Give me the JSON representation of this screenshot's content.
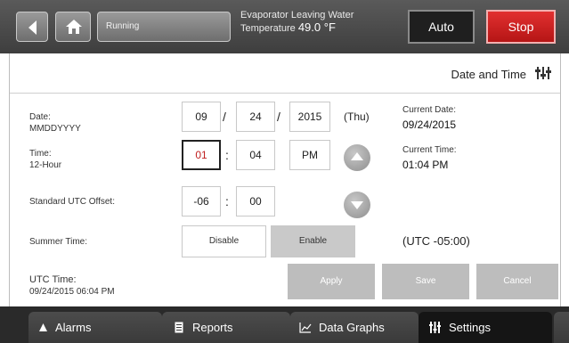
{
  "header": {
    "status_label": "Running",
    "reading_label": "Evaporator Leaving Water",
    "reading_prefix": "Temperature",
    "reading_value": "49.0 °F",
    "auto_label": "Auto",
    "stop_label": "Stop"
  },
  "panel": {
    "title": "Date and Time",
    "date": {
      "label": "Date:",
      "format": "MMDDYYYY",
      "month": "09",
      "day": "24",
      "year": "2015",
      "separator": "/",
      "weekday": "(Thu)"
    },
    "time": {
      "label": "Time:",
      "mode": "12-Hour",
      "hour": "01",
      "minute": "04",
      "separator": ":",
      "ampm": "PM"
    },
    "utc_offset": {
      "label": "Standard UTC Offset:",
      "hours": "-06",
      "minutes": "00",
      "separator": ":"
    },
    "summer_time": {
      "label": "Summer Time:",
      "disable_label": "Disable",
      "enable_label": "Enable",
      "selected": "Enable",
      "utc_now": "(UTC -05:00)"
    },
    "current_date": {
      "label": "Current Date:",
      "value": "09/24/2015"
    },
    "current_time": {
      "label": "Current Time:",
      "value": "01:04 PM"
    },
    "utc_time": {
      "label": "UTC Time:",
      "value": "09/24/2015 06:04 PM"
    },
    "actions": {
      "apply": "Apply",
      "save": "Save",
      "cancel": "Cancel"
    }
  },
  "nav": {
    "tabs": [
      {
        "label": "Alarms",
        "icon": "bell-icon"
      },
      {
        "label": "Reports",
        "icon": "document-icon"
      },
      {
        "label": "Data Graphs",
        "icon": "line-chart-icon"
      },
      {
        "label": "Settings",
        "icon": "sliders-icon",
        "active": true
      }
    ]
  },
  "colors": {
    "stop_red": "#c81d1d",
    "selected_field_text": "#c02020",
    "header_dark": "#3e3e3e",
    "active_toggle": "#c9c9c9"
  }
}
